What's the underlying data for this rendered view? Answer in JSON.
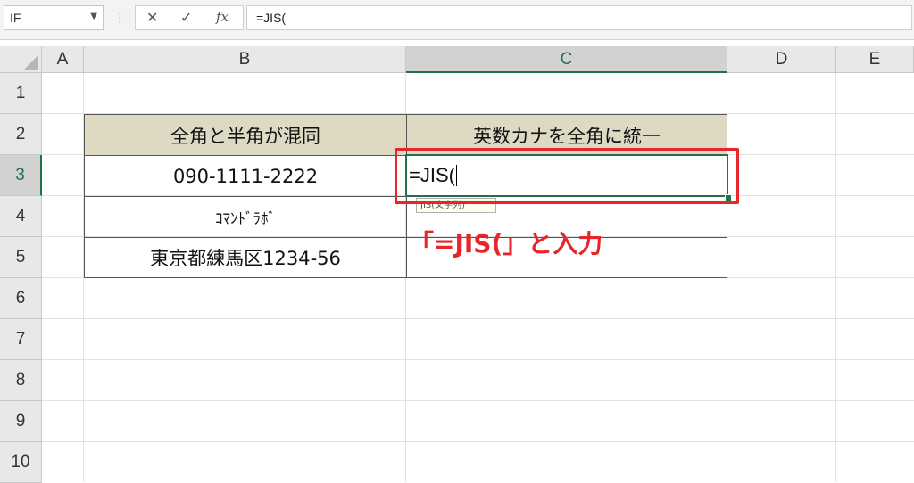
{
  "formula_bar": {
    "name_box": "IF",
    "cancel_icon": "✕",
    "enter_icon": "✓",
    "fx_label": "fx",
    "formula": "=JIS("
  },
  "columns": [
    "A",
    "B",
    "C",
    "D",
    "E"
  ],
  "rows": [
    "1",
    "2",
    "3",
    "4",
    "5",
    "6",
    "7",
    "8",
    "9",
    "10"
  ],
  "table": {
    "header_b": "全角と半角が混同",
    "header_c": "英数カナを全角に統一",
    "b3": "090-1111-2222",
    "b4": "ｺﾏﾝﾄﾞﾗﾎﾞ",
    "b5": "東京都練馬区1234-56",
    "c3_editing": "=JIS("
  },
  "tooltip": "JIS(文字列)",
  "annotation": "「=JIS(」と入力",
  "colors": {
    "accent": "#217346",
    "annotation": "#e8262a",
    "header_fill": "#ddd9c3"
  }
}
